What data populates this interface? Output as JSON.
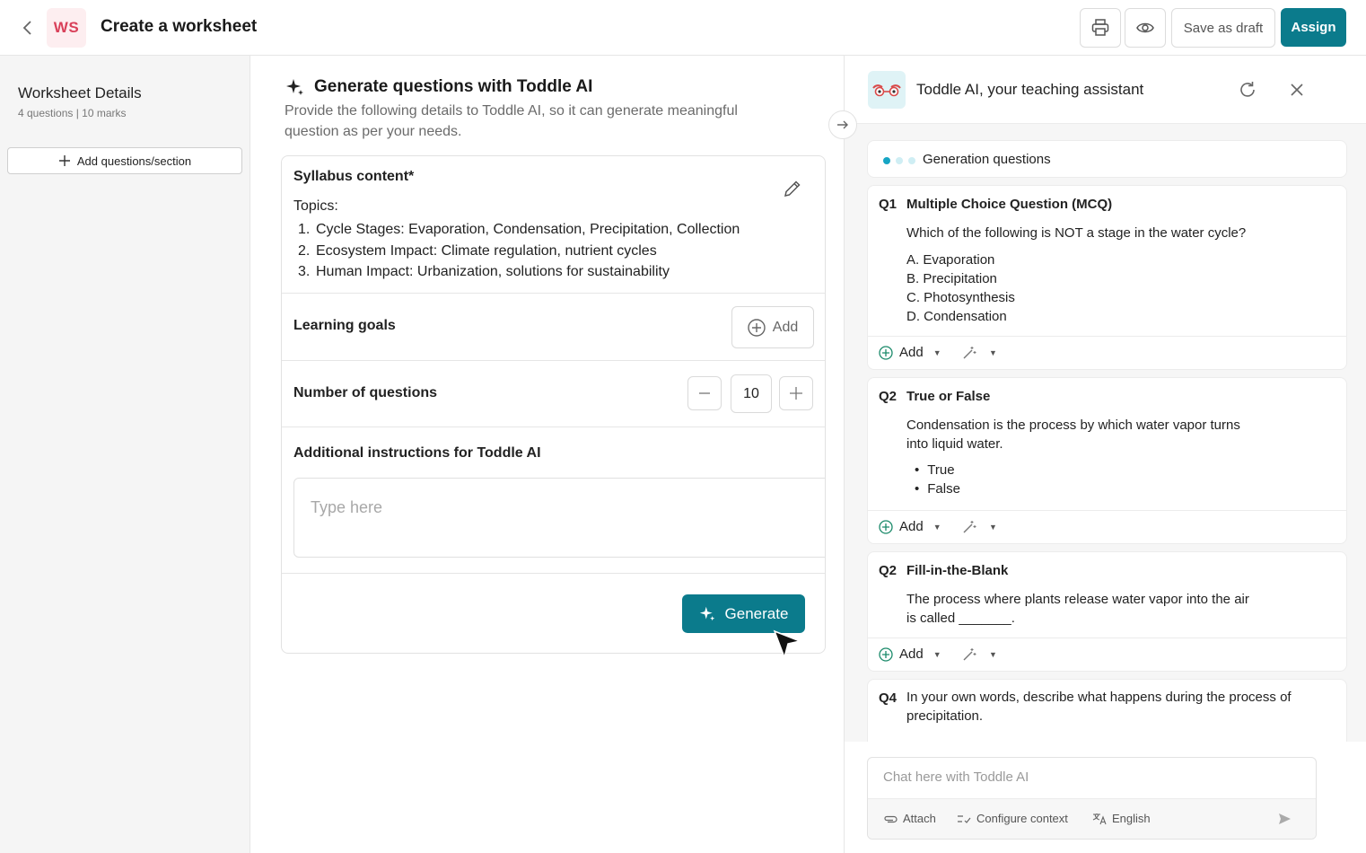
{
  "header": {
    "badge": "WS",
    "title": "Create a worksheet",
    "save_draft_label": "Save as draft",
    "assign_label": "Assign",
    "icons": [
      "back-arrow-icon",
      "printer-icon",
      "eye-icon"
    ]
  },
  "sidebar": {
    "title": "Worksheet Details",
    "subtitle": "4 questions | 10 marks",
    "add_button": "Add questions/section"
  },
  "generator": {
    "title": "Generate questions with Toddle AI",
    "description": "Provide the following details to Toddle AI, so it can generate meaningful question as per your needs.",
    "syllabus_label": "Syllabus content*",
    "topics_heading": "Topics:",
    "topics": [
      {
        "num": "1.",
        "text": "Cycle Stages: Evaporation, Condensation, Precipitation, Collection"
      },
      {
        "num": "2.",
        "text": "Ecosystem Impact: Climate regulation, nutrient cycles"
      },
      {
        "num": "3.",
        "text": "Human Impact: Urbanization, solutions for sustainability"
      }
    ],
    "learning_goals_label": "Learning goals",
    "add_label": "Add",
    "num_questions_label": "Number of questions",
    "num_questions_value": "10",
    "instructions_label": "Additional instructions for Toddle AI",
    "instructions_placeholder": "Type here",
    "generate_label": "Generate"
  },
  "ai_panel": {
    "title": "Toddle AI, your teaching assistant",
    "status": "Generation questions",
    "questions": [
      {
        "num": "Q1",
        "type": "Multiple Choice Question (MCQ)",
        "text": "Which of the following is NOT a stage in the water cycle?",
        "options": [
          "A. Evaporation",
          "B. Precipitation",
          "C. Photosynthesis",
          "D. Condensation"
        ]
      },
      {
        "num": "Q2",
        "type": "True or False",
        "text_line1": "Condensation is the process by which water vapor turns",
        "text_line2": "into liquid water.",
        "options": [
          "True",
          "False"
        ]
      },
      {
        "num": "Q2",
        "type": "Fill-in-the-Blank",
        "text_line1": "The process where plants release water vapor into the air",
        "text_line2": "is called _______."
      },
      {
        "num": "Q4",
        "text_line1": "In your own words, describe what happens during the process of",
        "text_line2": "precipitation."
      }
    ],
    "action_add": "Add",
    "chat_placeholder": "Chat here with Toddle AI",
    "attach_label": "Attach",
    "configure_label": "Configure context",
    "language_label": "English"
  },
  "colors": {
    "accent": "#0b7b8c",
    "badge_bg": "#fdeef0",
    "badge_text": "#d9415a",
    "status_dot": "#16a5c4"
  }
}
